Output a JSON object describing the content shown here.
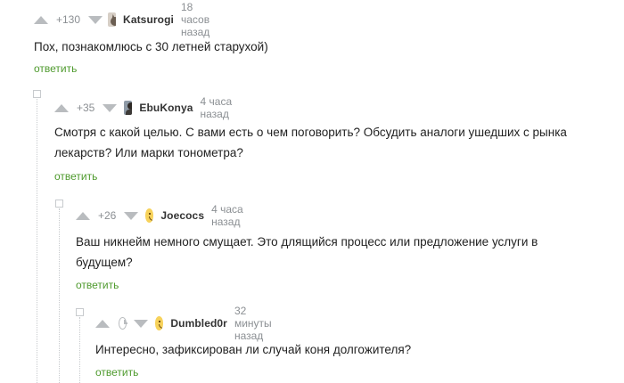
{
  "comments": [
    {
      "rating": "+130",
      "author": "Katsurogi",
      "time": "18 часов назад",
      "text": "Пох, познакомлюсь с 30 летней старухой)",
      "reply_label": "ответить",
      "avatar_icon": "cat-avatar"
    },
    {
      "rating": "+35",
      "author": "EbuKonya",
      "time": "4 часа назад",
      "text": "Смотря с какой целью. С вами есть о чем поговорить? Обсудить аналоги ушедших с рынка лекарств? Или марки тонометра?",
      "reply_label": "ответить",
      "avatar_icon": "person-avatar"
    },
    {
      "rating": "+26",
      "author": "Joecocs",
      "time": "4 часа назад",
      "text": "Ваш никнейм немного смущает. Это длящийся процесс или предложение услуги в будущем?",
      "reply_label": "ответить",
      "avatar_icon": "emoji-avatar"
    },
    {
      "rating_icon": "clock-icon",
      "author": "Dumbled0r",
      "time": "32 минуты назад",
      "text": "Интересно, зафиксирован ли случай коня долгожителя?",
      "reply_label": "ответить",
      "avatar_icon": "emoji-avatar"
    }
  ],
  "colors": {
    "reply_link": "#4e9a2d",
    "vote_arrow": "#b9bcbf",
    "meta_text": "#8b8f93"
  }
}
